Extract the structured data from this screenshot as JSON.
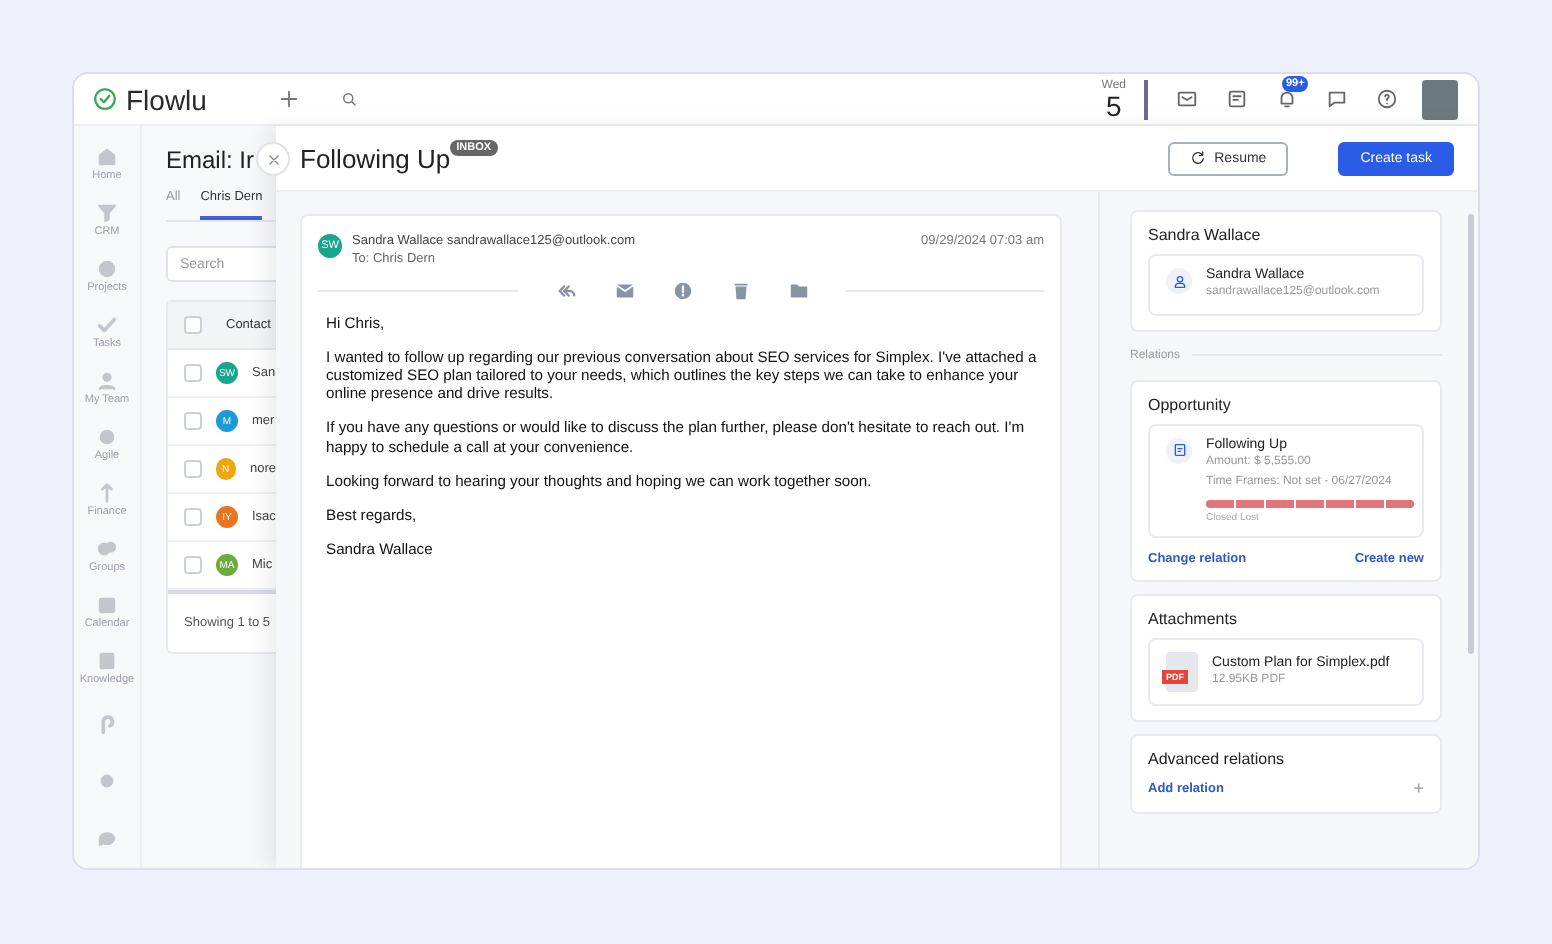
{
  "app": {
    "logo": "Flowlu"
  },
  "topbar": {
    "day_name": "Wed",
    "day": "5",
    "notification_badge": "99+"
  },
  "sidebar": {
    "items": [
      {
        "kind": "labeled",
        "label": "Home"
      },
      {
        "kind": "labeled",
        "label": "CRM"
      },
      {
        "kind": "labeled",
        "label": "Projects"
      },
      {
        "kind": "labeled",
        "label": "Tasks"
      },
      {
        "kind": "labeled",
        "label": "My Team"
      },
      {
        "kind": "labeled",
        "label": "Agile"
      },
      {
        "kind": "labeled",
        "label": "Finance"
      },
      {
        "kind": "labeled",
        "label": "Groups"
      },
      {
        "kind": "labeled",
        "label": "Calendar"
      },
      {
        "kind": "labeled",
        "label": "Knowledge"
      },
      {
        "kind": "icon"
      },
      {
        "kind": "icon"
      },
      {
        "kind": "icon"
      }
    ]
  },
  "list_page": {
    "title": "Email: Ir",
    "tabs": [
      {
        "label": "All",
        "selected": false
      },
      {
        "label": "Chris Dern",
        "selected": true
      }
    ],
    "search": {
      "placeholder": "Search"
    },
    "select_all": {
      "checked": false
    },
    "column": "Contact",
    "rows": [
      {
        "initials": "SW",
        "color": "#17a58c",
        "name": "San",
        "checked": false
      },
      {
        "initials": "M",
        "color": "#1c9ad6",
        "name": "mer",
        "checked": false
      },
      {
        "initials": "N",
        "color": "#f0a50a",
        "name": "nore",
        "checked": false
      },
      {
        "initials": "IY",
        "color": "#ea7420",
        "name": "Isac",
        "checked": false
      },
      {
        "initials": "MA",
        "color": "#6aac3c",
        "name": "Mic",
        "checked": false
      }
    ],
    "footer": "Showing 1 to 5"
  },
  "drawer": {
    "title": "Following Up",
    "badge": "INBOX",
    "buttons": [
      {
        "kind": "secondary",
        "label": "Resume"
      },
      {
        "kind": "primary",
        "label": "Create task"
      }
    ]
  },
  "email": {
    "sender_initials": "SW",
    "sender": "Sandra Wallace sandrawallace125@outlook.com",
    "to": "To: Chris Dern",
    "date": "09/29/2024 07:03 am",
    "paragraphs": [
      "Hi Chris,",
      "I wanted to follow up regarding our previous conversation about SEO services for Simplex. I've attached a customized SEO plan tailored to your needs, which outlines the key steps we can take to enhance your online presence and drive results.",
      "If you have any questions or would like to discuss the plan further, please don't hesitate to reach out. I'm happy to schedule a call at your convenience.",
      "Looking forward to hearing your thoughts and hoping we can work together soon.",
      "Best regards,",
      "Sandra Wallace"
    ]
  },
  "contact_card": {
    "title": "Sandra Wallace",
    "name": "Sandra Wallace",
    "email": "sandrawallace125@outlook.com"
  },
  "relations_label": "Relations",
  "opportunity": {
    "title": "Opportunity",
    "name": "Following Up",
    "amount": "Amount: $ 5,555.00",
    "time_frames": "Time Frames: Not set - 06/27/2024",
    "stage": {
      "level": 1
    },
    "stage_label": "Closed Lost",
    "links": [
      "Change relation",
      "Create new"
    ]
  },
  "attachments": {
    "title": "Attachments",
    "files": [
      {
        "icon_text": "PDF",
        "name": "Custom Plan for Simplex.pdf",
        "meta": "12.95KB PDF"
      }
    ]
  },
  "advanced_relations": {
    "title": "Advanced relations",
    "link": "Add relation",
    "add": "+"
  }
}
